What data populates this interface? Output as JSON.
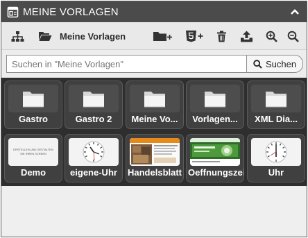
{
  "window": {
    "title": "MEINE VORLAGEN"
  },
  "toolbar": {
    "current_folder": "Meine Vorlagen"
  },
  "search": {
    "placeholder": "Suchen in \"Meine Vorlagen\"",
    "value": "",
    "button_label": "Suchen"
  },
  "folders": [
    {
      "label": "Gastro"
    },
    {
      "label": "Gastro 2"
    },
    {
      "label": "Meine Vo..."
    },
    {
      "label": "Vorlagen..."
    },
    {
      "label": "XML Dia..."
    }
  ],
  "templates": [
    {
      "label": "Demo",
      "thumb_text": "ERSTELLEN UND GESTALTEN SIE IHREN SCREEN"
    },
    {
      "label": "eigene-Uhr"
    },
    {
      "label": "Handelsblatt"
    },
    {
      "label": "Oeffnungszeiten"
    },
    {
      "label": "Uhr"
    }
  ],
  "colors": {
    "titlebar": "#4b4b4b",
    "grid_background": "#2e2e2e",
    "tile": "#404040"
  }
}
